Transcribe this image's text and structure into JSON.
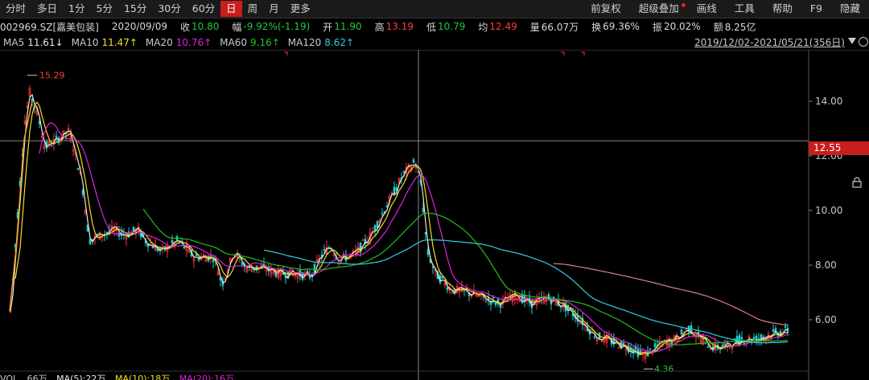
{
  "toolbar": {
    "periods": [
      "分时",
      "多日",
      "1分",
      "5分",
      "15分",
      "30分",
      "60分",
      "日",
      "周",
      "月",
      "更多"
    ],
    "active_index": 7,
    "right": [
      "前复权",
      "超级叠加",
      "画线",
      "工具",
      "帮助",
      "F9",
      "隐藏"
    ]
  },
  "quote": {
    "code": "002969.SZ[嘉美包装]",
    "date": "2020/09/09",
    "close_label": "收",
    "close_value": "10.80",
    "chg_label": "幅",
    "chg_value": "-9.92%(-1.19)",
    "open_label": "开",
    "open_value": "11.90",
    "high_label": "高",
    "high_value": "13.19",
    "low_label": "低",
    "low_value": "10.79",
    "avg_label": "均",
    "avg_value": "12.49",
    "vol_label": "量",
    "vol_value": "66.07万",
    "turnover_label": "换",
    "turnover_value": "69.36%",
    "amp_label": "振",
    "amp_value": "20.02%",
    "amount_label": "额",
    "amount_value": "8.25亿"
  },
  "ma": [
    {
      "label": "MA5",
      "value": "11.61↓",
      "color": "#e8e8e8"
    },
    {
      "label": "MA10",
      "value": "11.47↑",
      "color": "#f0e020"
    },
    {
      "label": "MA20",
      "value": "10.76↑",
      "color": "#e020e0"
    },
    {
      "label": "MA60",
      "value": "9.16↑",
      "color": "#20c020"
    },
    {
      "label": "MA120",
      "value": "8.62↑",
      "color": "#30d0e0"
    }
  ],
  "range": "2019/12/02-2021/05/21(356日)",
  "crosshair_price": "12.55",
  "vol_row": {
    "label": "VOL",
    "items": [
      "66万",
      "MA(5):22万",
      "MA(10):18万",
      "MA(20):16万"
    ]
  },
  "chart_data": {
    "type": "candlestick",
    "y_ticks": [
      "14.00",
      "12.00",
      "10.00",
      "8.00",
      "6.00"
    ],
    "ylim": [
      4.0,
      15.5
    ],
    "high_mark": "15.29",
    "low_mark": "4.36",
    "colors": {
      "up": "#ff3232",
      "down": "#20d0d0",
      "ma5": "#e8e8e8",
      "ma10": "#f0e020",
      "ma20": "#e020e0",
      "ma60": "#20c020",
      "ma120": "#30d0e0",
      "ma250": "#e08080"
    }
  }
}
